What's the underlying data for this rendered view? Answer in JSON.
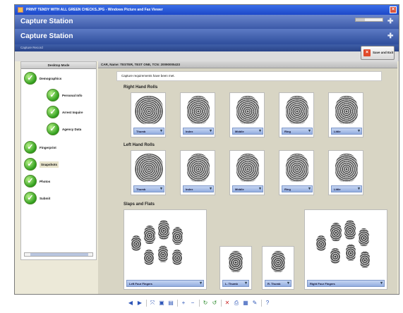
{
  "window": {
    "title": "PRINT TENDY WITH ALL GREEN CHECKS.JPG - Windows Picture and Fax Viewer",
    "close_glyph": "×"
  },
  "app": {
    "banner_title": "Capture Station",
    "banner_subtitle": "Capture Station",
    "subbar_text": "Capture Record",
    "save_exit_label": "Save and Exit",
    "save_exit_icon": "×"
  },
  "sidebar": {
    "header": "Desktop Mode",
    "steps": [
      {
        "label": "Demographics"
      },
      {
        "label": "Personal Info"
      },
      {
        "label": "Arrest Inquire"
      },
      {
        "label": "Agency Data"
      },
      {
        "label": "Fingerprint"
      },
      {
        "label": "Snapshots"
      },
      {
        "label": "Photos"
      },
      {
        "label": "Submit"
      }
    ],
    "check_glyph": "✓"
  },
  "main": {
    "header": "CAR, Name: TESTER, TEST ONE, TCN: 20090005433",
    "message": "Capture requirements have been met.",
    "right_title": "Right Hand Rolls",
    "left_title": "Left Hand Rolls",
    "slaps_title": "Slaps and Flats",
    "right_fingers": [
      "Thumb",
      "Index",
      "Middle",
      "Ring",
      "Little"
    ],
    "left_fingers": [
      "Thumb",
      "Index",
      "Middle",
      "Ring",
      "Little"
    ],
    "slaps": [
      "Left Four Fingers",
      "L. Thumb",
      "R. Thumb",
      "Right Four Fingers"
    ]
  },
  "viewer_toolbar": {
    "icons": [
      "previous-icon",
      "next-icon",
      "best-fit-icon",
      "actual-size-icon",
      "slideshow-icon",
      "zoom-in-icon",
      "zoom-out-icon",
      "rotate-clockwise-icon",
      "rotate-counterclockwise-icon",
      "delete-icon",
      "print-icon",
      "save-icon",
      "edit-icon",
      "help-icon"
    ]
  }
}
